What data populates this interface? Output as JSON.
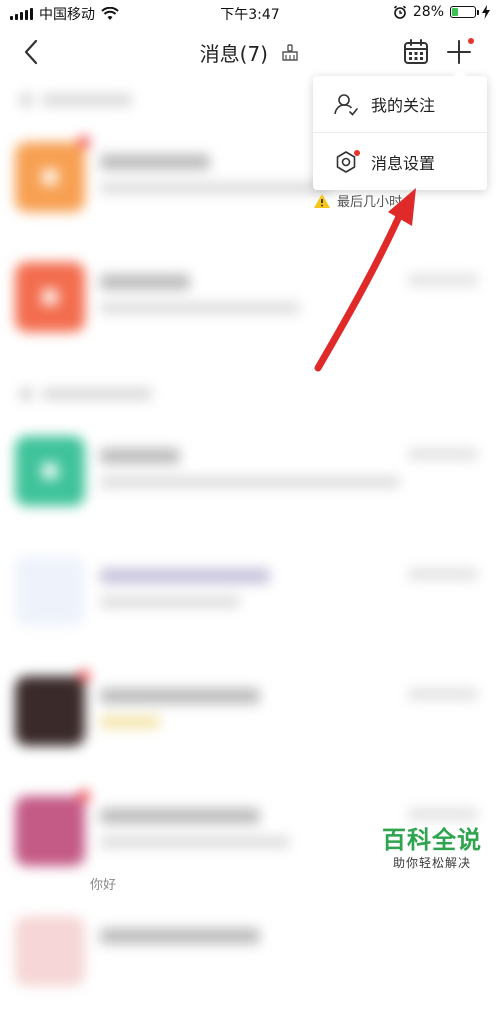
{
  "status_bar": {
    "carrier": "中国移动",
    "time": "下午3:47",
    "battery_percent": "28%",
    "battery_level": 0.28,
    "battery_color": "#3ec256"
  },
  "nav": {
    "title": "消息(7)",
    "icons": [
      "back-chevron-icon",
      "broom-icon",
      "calendar-icon",
      "plus-icon"
    ]
  },
  "menu": {
    "items": [
      {
        "label": "我的关注",
        "icon": "person-follow-icon"
      },
      {
        "label": "消息设置",
        "icon": "settings-gear-icon"
      }
    ]
  },
  "warning_text": "最后几小时...",
  "watermark": {
    "logo_text": "百科全说",
    "subtitle": "助你轻松解决",
    "color": "#2ea44f"
  },
  "bottom_partial_text": "你好",
  "colors": {
    "accent_red": "#e8342d",
    "arrow_red": "#e02a2a",
    "avatar_orange": "#f7a052",
    "avatar_coral": "#f36d4e",
    "avatar_teal": "#3fc39a"
  }
}
